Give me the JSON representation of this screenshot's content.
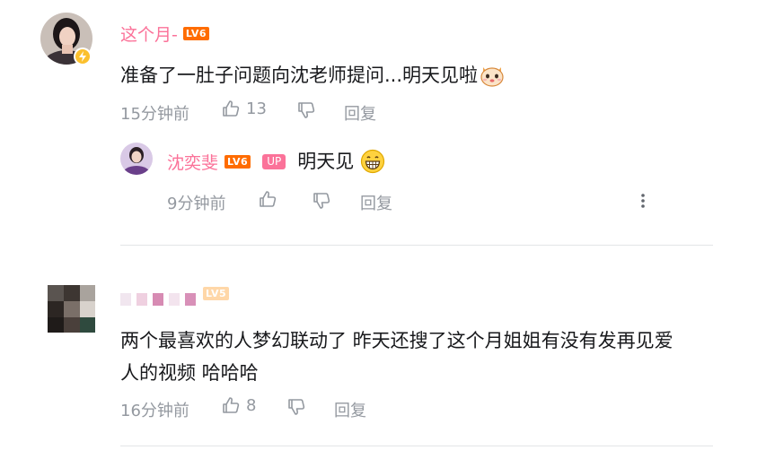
{
  "comments": [
    {
      "username": "这个月-",
      "level": "LV6",
      "content": "准备了一肚子问题向沈老师提问...明天见啦",
      "emoji": "cat-emoji",
      "time": "15分钟前",
      "likes": "13",
      "reply_label": "回复",
      "replies": [
        {
          "username": "沈奕斐",
          "level": "LV6",
          "up_badge": "UP",
          "content": "明天见",
          "emoji": "grin-emoji",
          "time": "9分钟前",
          "reply_label": "回复"
        }
      ]
    },
    {
      "username": "",
      "level": "LV5",
      "content_line1": "两个最喜欢的人梦幻联动了 昨天还搜了这个月姐姐有没有发再见爱",
      "content_line2": "人的视频 哈哈哈",
      "time": "16分钟前",
      "likes": "8",
      "reply_label": "回复"
    }
  ],
  "colors": {
    "username": "#fb7299",
    "level": "#ff6c00",
    "meta": "#9499a0",
    "text": "#18191c"
  }
}
